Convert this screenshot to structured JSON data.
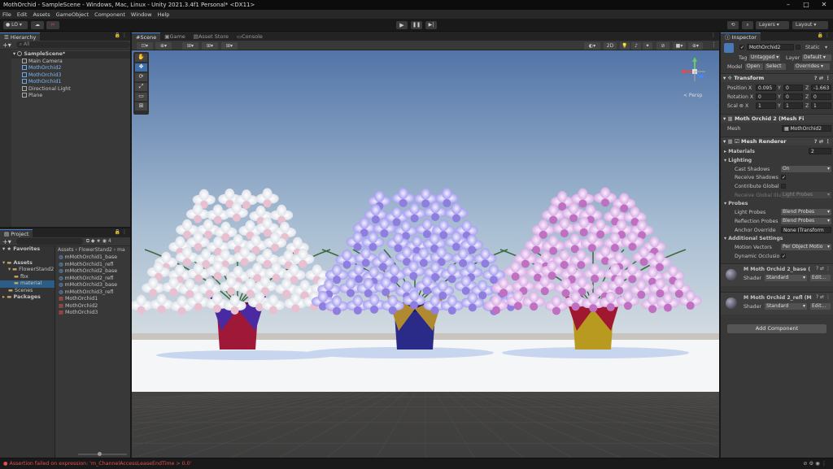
{
  "window": {
    "title": "MothOrchid - SampleScene - Windows, Mac, Linux - Unity 2021.3.4f1 Personal* <DX11>"
  },
  "menu": [
    "File",
    "Edit",
    "Assets",
    "GameObject",
    "Component",
    "Window",
    "Help"
  ],
  "toolbar": {
    "account": "LO",
    "layers": "Layers",
    "layout": "Layout"
  },
  "hierarchy": {
    "tab": "Hierarchy",
    "search": "All",
    "items": [
      {
        "label": "SampleScene*",
        "depth": 0,
        "blue": false,
        "scene": true
      },
      {
        "label": "Main Camera",
        "depth": 1,
        "blue": false
      },
      {
        "label": "MothOrchid2",
        "depth": 1,
        "blue": true
      },
      {
        "label": "MothOrchid3",
        "depth": 1,
        "blue": true
      },
      {
        "label": "MothOrchid1",
        "depth": 1,
        "blue": true
      },
      {
        "label": "Directional Light",
        "depth": 1,
        "blue": false
      },
      {
        "label": "Plane",
        "depth": 1,
        "blue": false
      }
    ]
  },
  "project": {
    "tab": "Project",
    "count": "4",
    "breadcrumb": [
      "Assets",
      "FlowerStand2",
      "ma"
    ],
    "tree": [
      {
        "label": "Favorites",
        "depth": 0
      },
      {
        "label": "Assets",
        "depth": 0
      },
      {
        "label": "FlowerStand2",
        "depth": 1
      },
      {
        "label": "fbx",
        "depth": 2
      },
      {
        "label": "material",
        "depth": 2
      },
      {
        "label": "Scenes",
        "depth": 1
      },
      {
        "label": "Packages",
        "depth": 0
      }
    ],
    "files": [
      "mMothOrchid1_base",
      "mMothOrchid1_refl",
      "mMothOrchid2_base",
      "mMothOrchid2_refl",
      "mMothOrchid3_base",
      "mMothOrchid3_refl",
      "MothOrchid1",
      "MothOrchid2",
      "MothOrchid3"
    ]
  },
  "scene_tabs": [
    "Scene",
    "Game",
    "Asset Store",
    "Console"
  ],
  "scene": {
    "mode_2d": "2D",
    "persp": "< Persp"
  },
  "inspector": {
    "tab": "Inspector",
    "name": "MothOrchid2",
    "static": "Static",
    "tag_label": "Tag",
    "tag": "Untagged",
    "layer_label": "Layer",
    "layer": "Default",
    "model_label": "Model",
    "open": "Open",
    "select": "Select",
    "overrides": "Overrides",
    "transform": {
      "title": "Transform",
      "pos_label": "Position",
      "rot_label": "Rotation",
      "scale_label": "Scal",
      "pos": [
        "0.095",
        "0",
        "-1.663"
      ],
      "rot": [
        "0",
        "0",
        "0"
      ],
      "scale": [
        "1",
        "1",
        "1"
      ]
    },
    "meshfilter": {
      "title": "Moth Orchid 2 (Mesh Fi",
      "mesh_label": "Mesh",
      "mesh": "MothOrchid2"
    },
    "renderer": {
      "title": "Mesh Renderer",
      "materials_label": "Materials",
      "materials": "2",
      "lighting": "Lighting",
      "cast_shadows_label": "Cast Shadows",
      "cast_shadows": "On",
      "receive_shadows_label": "Receive Shadows",
      "contribute_gi_label": "Contribute Global I",
      "receive_gi_label": "Receive Global Illu",
      "receive_gi": "Light Probes",
      "probes": "Probes",
      "light_probes_label": "Light Probes",
      "light_probes": "Blend Probes",
      "reflection_probes_label": "Reflection Probes",
      "reflection_probes": "Blend Probes",
      "anchor_label": "Anchor Override",
      "anchor": "None (Transform",
      "additional": "Additional Settings",
      "motion_label": "Motion Vectors",
      "motion": "Per Object Motio",
      "dynamic_label": "Dynamic Occlusio"
    },
    "materials": [
      {
        "name": "M Moth Orchid 2_base (",
        "shader_label": "Shader",
        "shader": "Standard",
        "edit": "Edit..."
      },
      {
        "name": "M Moth Orchid 2_refl (M",
        "shader_label": "Shader",
        "shader": "Standard",
        "edit": "Edit..."
      }
    ],
    "add_component": "Add Component"
  },
  "status": {
    "message": "Assertion failed on expression: 'm_ChannelAccessLeaseEndTime > 0.0'"
  }
}
